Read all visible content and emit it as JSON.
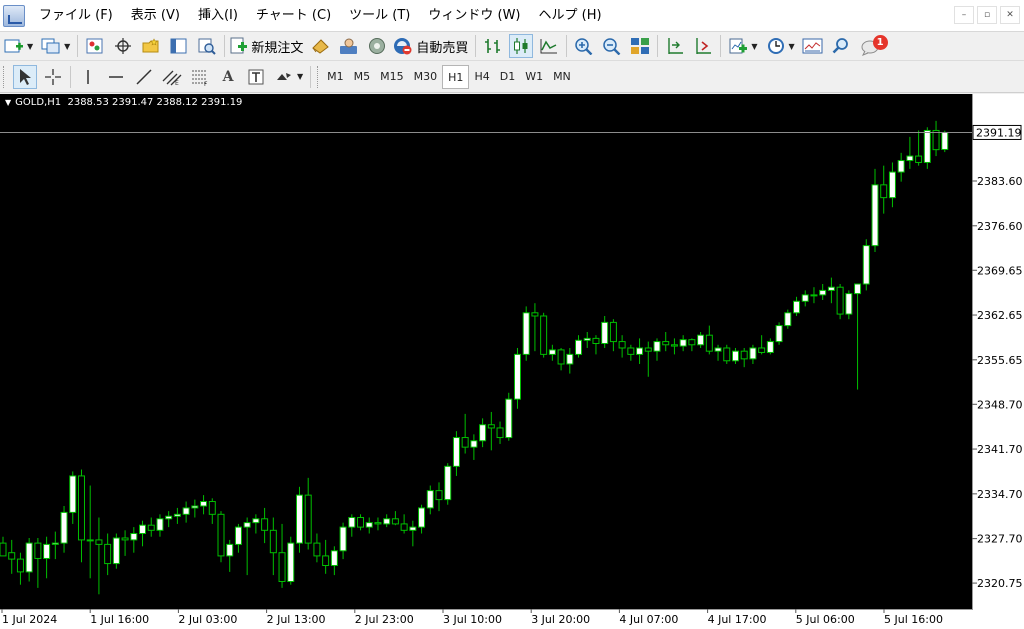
{
  "menu": [
    "ファイル (F)",
    "表示 (V)",
    "挿入(I)",
    "チャート (C)",
    "ツール (T)",
    "ウィンドウ (W)",
    "ヘルプ (H)"
  ],
  "toolbar": {
    "new_order_label": "新規注文",
    "auto_trade_label": "自動売買",
    "notification_count": "1"
  },
  "timeframes": [
    "M1",
    "M5",
    "M15",
    "M30",
    "H1",
    "H4",
    "D1",
    "W1",
    "MN"
  ],
  "active_timeframe": "H1",
  "chart": {
    "symbol": "GOLD,H1",
    "ohlc": "2388.53 2391.47 2388.12 2391.19",
    "current_price": "2391.19"
  },
  "colors": {
    "background": "#000000",
    "bull_candle": "#ffffff",
    "bear_candle": "#000000",
    "candle_outline": "#00c000",
    "price_line": "#8c8c8c",
    "axis_text": "#000000"
  },
  "chart_data": {
    "type": "candlestick",
    "ylim": [
      2316.7,
      2397.2
    ],
    "y_ticks": [
      "2383.60",
      "2376.60",
      "2369.65",
      "2362.65",
      "2355.65",
      "2348.70",
      "2341.70",
      "2334.70",
      "2327.70",
      "2320.75"
    ],
    "x_ticks": [
      "1 Jul 2024",
      "1 Jul 16:00",
      "2 Jul 03:00",
      "2 Jul 13:00",
      "2 Jul 23:00",
      "3 Jul 10:00",
      "3 Jul 20:00",
      "4 Jul 07:00",
      "4 Jul 17:00",
      "5 Jul 06:00",
      "5 Jul 16:00"
    ],
    "candles": [
      [
        2327.0,
        2328.0,
        2325.2,
        2325.0
      ],
      [
        2325.5,
        2327.5,
        2322.2,
        2324.5
      ],
      [
        2324.5,
        2325.5,
        2320.5,
        2322.5
      ],
      [
        2322.5,
        2327.8,
        2321.0,
        2327.0
      ],
      [
        2327.0,
        2327.8,
        2320.0,
        2324.6
      ],
      [
        2324.6,
        2328.0,
        2321.5,
        2326.8
      ],
      [
        2326.8,
        2328.8,
        2324.5,
        2327.0
      ],
      [
        2327.0,
        2332.8,
        2325.5,
        2331.8
      ],
      [
        2331.8,
        2338.2,
        2330.0,
        2337.5
      ],
      [
        2337.5,
        2338.5,
        2324.0,
        2327.5
      ],
      [
        2327.5,
        2336.0,
        2321.5,
        2327.5
      ],
      [
        2327.5,
        2331.0,
        2319.0,
        2326.8
      ],
      [
        2326.8,
        2328.5,
        2322.0,
        2323.8
      ],
      [
        2323.8,
        2328.5,
        2323.0,
        2327.8
      ],
      [
        2327.8,
        2329.0,
        2325.0,
        2327.5
      ],
      [
        2327.5,
        2329.5,
        2325.5,
        2328.5
      ],
      [
        2328.5,
        2330.5,
        2326.5,
        2329.8
      ],
      [
        2329.8,
        2331.0,
        2328.0,
        2329.0
      ],
      [
        2329.0,
        2331.5,
        2328.0,
        2330.8
      ],
      [
        2330.8,
        2332.0,
        2329.5,
        2331.2
      ],
      [
        2331.2,
        2332.5,
        2330.0,
        2331.5
      ],
      [
        2331.5,
        2333.5,
        2330.2,
        2332.5
      ],
      [
        2332.5,
        2333.8,
        2331.0,
        2332.8
      ],
      [
        2332.8,
        2334.5,
        2331.5,
        2333.5
      ],
      [
        2333.5,
        2334.0,
        2330.0,
        2331.5
      ],
      [
        2331.5,
        2332.0,
        2324.0,
        2325.0
      ],
      [
        2325.0,
        2327.5,
        2322.5,
        2326.8
      ],
      [
        2326.8,
        2330.0,
        2325.5,
        2329.5
      ],
      [
        2329.5,
        2331.0,
        2322.0,
        2330.2
      ],
      [
        2330.2,
        2331.5,
        2328.5,
        2330.8
      ],
      [
        2330.8,
        2332.5,
        2327.0,
        2329.0
      ],
      [
        2329.0,
        2331.0,
        2322.0,
        2325.5
      ],
      [
        2325.5,
        2330.0,
        2320.0,
        2321.0
      ],
      [
        2321.0,
        2328.0,
        2320.5,
        2327.0
      ],
      [
        2327.0,
        2335.8,
        2325.5,
        2334.5
      ],
      [
        2334.5,
        2337.2,
        2326.0,
        2327.0
      ],
      [
        2327.0,
        2328.5,
        2324.0,
        2325.0
      ],
      [
        2325.0,
        2327.5,
        2322.2,
        2323.5
      ],
      [
        2323.5,
        2326.5,
        2322.0,
        2325.8
      ],
      [
        2325.8,
        2330.2,
        2324.5,
        2329.5
      ],
      [
        2329.5,
        2331.5,
        2328.0,
        2331.0
      ],
      [
        2331.0,
        2331.5,
        2329.0,
        2329.5
      ],
      [
        2329.5,
        2331.0,
        2328.5,
        2330.2
      ],
      [
        2330.2,
        2331.0,
        2329.0,
        2330.0
      ],
      [
        2330.0,
        2331.5,
        2329.5,
        2330.8
      ],
      [
        2330.8,
        2332.0,
        2329.8,
        2330.0
      ],
      [
        2330.0,
        2331.5,
        2328.5,
        2329.0
      ],
      [
        2329.0,
        2330.5,
        2326.5,
        2329.5
      ],
      [
        2329.5,
        2333.0,
        2328.5,
        2332.5
      ],
      [
        2332.5,
        2336.0,
        2331.5,
        2335.2
      ],
      [
        2335.2,
        2336.5,
        2332.0,
        2333.8
      ],
      [
        2333.8,
        2339.5,
        2333.0,
        2339.0
      ],
      [
        2339.0,
        2344.5,
        2337.5,
        2343.5
      ],
      [
        2343.5,
        2347.2,
        2341.0,
        2342.0
      ],
      [
        2342.0,
        2344.0,
        2340.0,
        2343.0
      ],
      [
        2343.0,
        2346.5,
        2342.0,
        2345.5
      ],
      [
        2345.5,
        2347.5,
        2341.5,
        2345.0
      ],
      [
        2345.0,
        2346.0,
        2342.5,
        2343.5
      ],
      [
        2343.5,
        2350.5,
        2343.0,
        2349.5
      ],
      [
        2349.5,
        2357.5,
        2348.0,
        2356.5
      ],
      [
        2356.5,
        2364.0,
        2355.5,
        2363.0
      ],
      [
        2363.0,
        2364.5,
        2357.0,
        2362.5
      ],
      [
        2362.5,
        2363.0,
        2356.0,
        2356.5
      ],
      [
        2356.5,
        2358.0,
        2355.5,
        2357.2
      ],
      [
        2357.2,
        2357.5,
        2354.0,
        2355.0
      ],
      [
        2355.0,
        2357.5,
        2353.5,
        2356.5
      ],
      [
        2356.5,
        2359.5,
        2356.0,
        2358.7
      ],
      [
        2358.7,
        2360.0,
        2357.5,
        2359.0
      ],
      [
        2359.0,
        2359.5,
        2356.5,
        2358.2
      ],
      [
        2358.2,
        2362.5,
        2357.5,
        2361.5
      ],
      [
        2361.5,
        2362.0,
        2357.0,
        2358.5
      ],
      [
        2358.5,
        2359.5,
        2356.0,
        2357.5
      ],
      [
        2357.5,
        2358.0,
        2355.5,
        2356.5
      ],
      [
        2356.5,
        2359.0,
        2355.0,
        2357.5
      ],
      [
        2357.5,
        2358.5,
        2353.0,
        2357.0
      ],
      [
        2357.0,
        2359.0,
        2355.5,
        2358.5
      ],
      [
        2358.5,
        2360.0,
        2357.0,
        2358.0
      ],
      [
        2358.0,
        2359.0,
        2356.5,
        2357.8
      ],
      [
        2357.8,
        2359.5,
        2357.0,
        2358.8
      ],
      [
        2358.8,
        2359.0,
        2357.0,
        2358.0
      ],
      [
        2358.0,
        2360.0,
        2357.5,
        2359.5
      ],
      [
        2359.5,
        2361.0,
        2356.5,
        2357.0
      ],
      [
        2357.0,
        2358.0,
        2355.5,
        2357.5
      ],
      [
        2357.5,
        2358.0,
        2355.0,
        2355.5
      ],
      [
        2355.5,
        2357.5,
        2355.0,
        2357.0
      ],
      [
        2357.0,
        2357.5,
        2354.5,
        2355.8
      ],
      [
        2355.8,
        2358.0,
        2355.0,
        2357.5
      ],
      [
        2357.5,
        2359.5,
        2356.5,
        2356.8
      ],
      [
        2356.8,
        2359.0,
        2356.5,
        2358.5
      ],
      [
        2358.5,
        2361.5,
        2358.0,
        2361.0
      ],
      [
        2361.0,
        2363.5,
        2360.5,
        2363.0
      ],
      [
        2363.0,
        2365.5,
        2362.5,
        2364.8
      ],
      [
        2364.8,
        2366.5,
        2364.0,
        2365.8
      ],
      [
        2365.8,
        2367.0,
        2364.5,
        2365.8
      ],
      [
        2365.8,
        2367.5,
        2365.0,
        2366.5
      ],
      [
        2366.5,
        2368.5,
        2364.5,
        2367.0
      ],
      [
        2367.0,
        2367.5,
        2362.0,
        2362.8
      ],
      [
        2362.8,
        2366.5,
        2362.0,
        2366.0
      ],
      [
        2366.0,
        2367.0,
        2351.0,
        2367.5
      ],
      [
        2367.5,
        2374.5,
        2366.5,
        2373.5
      ],
      [
        2373.5,
        2385.5,
        2372.5,
        2383.0
      ],
      [
        2383.0,
        2386.0,
        2378.5,
        2381.0
      ],
      [
        2381.0,
        2386.5,
        2379.5,
        2385.0
      ],
      [
        2385.0,
        2388.0,
        2383.5,
        2386.8
      ],
      [
        2386.8,
        2390.5,
        2385.5,
        2387.5
      ],
      [
        2387.5,
        2391.5,
        2386.0,
        2386.5
      ],
      [
        2386.5,
        2392.0,
        2385.5,
        2391.5
      ],
      [
        2391.5,
        2393.0,
        2387.5,
        2388.5
      ],
      [
        2388.53,
        2391.47,
        2388.12,
        2391.19
      ]
    ]
  }
}
